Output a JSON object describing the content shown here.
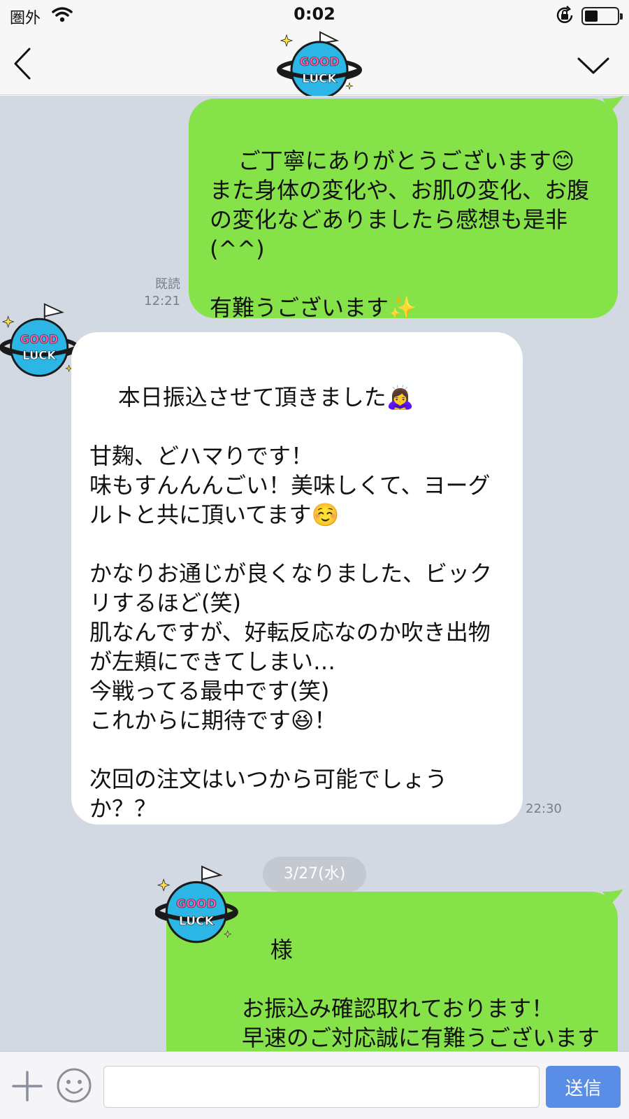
{
  "status_bar": {
    "carrier": "圏外",
    "time": "0:02"
  },
  "header": {
    "avatar_text_top": "GOOD",
    "avatar_text_bottom": "LUCK"
  },
  "colors": {
    "sent_bubble": "#85e249",
    "received_bubble": "#ffffff",
    "chat_background": "#d3d9e3",
    "send_button": "#5a8ee6"
  },
  "messages": [
    {
      "direction": "sent",
      "text": "ご丁寧にありがとうございます😊\nまた身体の変化や、お肌の変化、お腹の変化などありましたら感想も是非(^^)\n\n有難うございます✨",
      "read_label": "既読",
      "time": "12:21"
    },
    {
      "direction": "received",
      "text": "本日振込させて頂きました🙇‍♀️\n\n甘麹、どハマりです！\n味もすんんんごい！美味しくて、ヨーグルトと共に頂いてます☺️\n\nかなりお通じが良くなりました、ビックリするほど(笑)\n肌なんですが、好転反応なのか吹き出物が左頬にできてしまい…\n今戦ってる最中です(笑)\nこれからに期待です😆！\n\n次回の注文はいつから可能でしょうか？？",
      "time": "22:30"
    },
    {
      "direction": "sent",
      "text": "様\n\nお振込み確認取れております！\n早速のご対応誠に有難うございます\n(^^)"
    }
  ],
  "date_separator": "3/27(水)",
  "input_bar": {
    "placeholder": "",
    "send_label": "送信"
  }
}
